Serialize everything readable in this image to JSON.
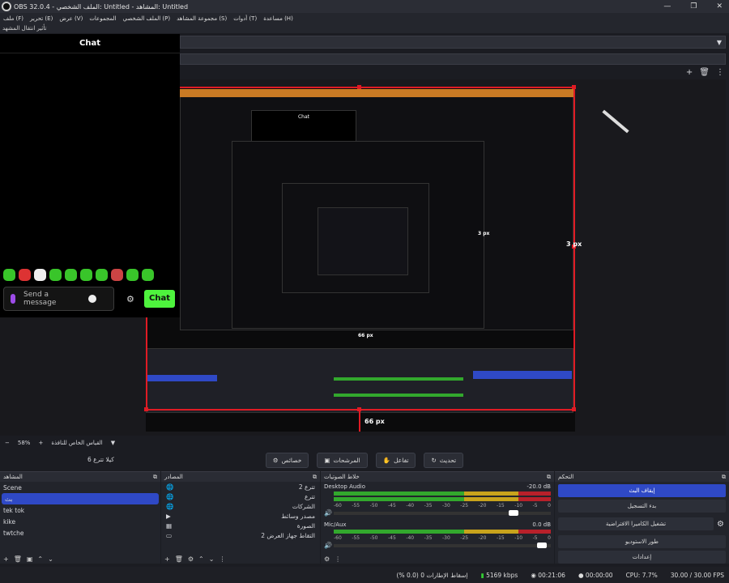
{
  "window": {
    "title": "OBS 32.0.4 - الملف الشخصي: Untitled - المشاهد: Untitled"
  },
  "menu": [
    "ملف (F)",
    "تحرير (E)",
    "عرض (V)",
    "المجموعات",
    "الملف الشخصي (P)",
    "مجموعة المشاهد (S)",
    "أدوات (T)",
    "مساعدة (H)"
  ],
  "transition_label": "تأثير انتقال المشهد",
  "chat": {
    "title": "Chat",
    "placeholder_line1": "Send a",
    "placeholder_line2": "message",
    "button": "Chat"
  },
  "preview": {
    "label_right": "3 px",
    "label_bottom": "66 px",
    "nested_right": "3 px",
    "nested_bottom": "66 px",
    "nested_chat": "Chat"
  },
  "zoom": {
    "value": "58%",
    "fit_label": "القياس الخاص للنافذة"
  },
  "toolbar": {
    "scene_label": "كيلا تترع 6",
    "properties": "خصائص",
    "filters": "المرشحات",
    "interact": "تفاعل",
    "refresh": "تحديث"
  },
  "scenes": {
    "title": "المشاهد",
    "items": [
      "Scene",
      "بث",
      "tek tok",
      "kike",
      "twtche"
    ],
    "selected": 1
  },
  "sources": {
    "title": "المصادر",
    "items": [
      "تترع 2",
      "تترع",
      "الشركات",
      "مصدر وسائط",
      "الصورة",
      "التقاط جهاز العرض 2"
    ]
  },
  "mixer": {
    "title": "خلاط الصوتيات",
    "channels": [
      {
        "name": "Desktop Audio",
        "db": "-20.0 dB",
        "vol": 0.85
      },
      {
        "name": "Mic/Aux",
        "db": "0.0 dB",
        "vol": 0.98
      }
    ],
    "ticks": [
      "-60",
      "-55",
      "-50",
      "-45",
      "-40",
      "-35",
      "-30",
      "-25",
      "-20",
      "-15",
      "-10",
      "-5",
      "0"
    ]
  },
  "controls": {
    "title": "التحكم",
    "items": [
      "إيقاف البث",
      "بدء التسجيل",
      "تشغيل الكاميرا الافتراضية",
      "طور الاستوديو",
      "إعدادات"
    ]
  },
  "status": {
    "dropped": "إسقاط الإطارات 0 (0.0 %)",
    "kbps": "5169 kbps",
    "stream_time": "00:21:06",
    "rec_time": "00:00:00",
    "cpu": "CPU: 7.7%",
    "fps": "30.00 / 30.00 FPS"
  }
}
